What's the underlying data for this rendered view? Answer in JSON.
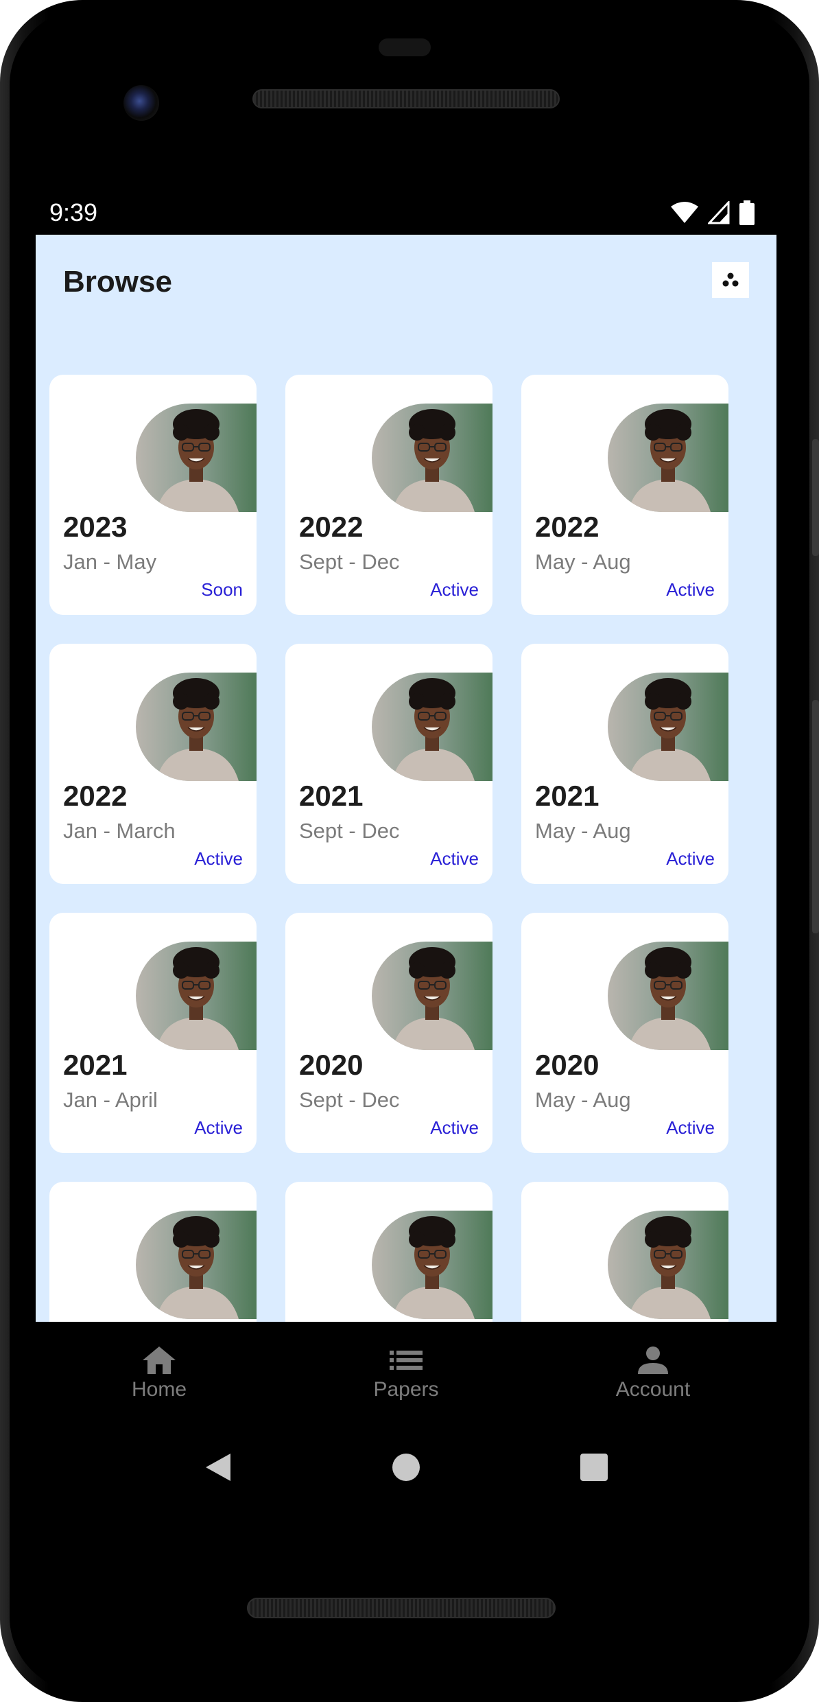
{
  "status_bar": {
    "time": "9:39"
  },
  "header": {
    "title": "Browse",
    "action_icon": "dots-cluster-icon"
  },
  "cards": [
    {
      "year": "2023",
      "range": "Jan - May",
      "status": "Soon"
    },
    {
      "year": "2022",
      "range": "Sept - Dec",
      "status": "Active"
    },
    {
      "year": "2022",
      "range": "May - Aug",
      "status": "Active"
    },
    {
      "year": "2022",
      "range": "Jan - March",
      "status": "Active"
    },
    {
      "year": "2021",
      "range": "Sept - Dec",
      "status": "Active"
    },
    {
      "year": "2021",
      "range": "May - Aug",
      "status": "Active"
    },
    {
      "year": "2021",
      "range": "Jan - April",
      "status": "Active"
    },
    {
      "year": "2020",
      "range": "Sept - Dec",
      "status": "Active"
    },
    {
      "year": "2020",
      "range": "May - Aug",
      "status": "Active"
    },
    {
      "year": "",
      "range": "",
      "status": ""
    },
    {
      "year": "",
      "range": "",
      "status": ""
    },
    {
      "year": "",
      "range": "",
      "status": ""
    }
  ],
  "bottom_nav": {
    "items": [
      {
        "label": "Home",
        "icon": "home-icon"
      },
      {
        "label": "Papers",
        "icon": "list-icon"
      },
      {
        "label": "Account",
        "icon": "person-icon"
      }
    ]
  },
  "colors": {
    "screen_bg": "#dbecff",
    "status_accent": "#2a21d6",
    "nav_inactive": "#7d7d7d"
  }
}
